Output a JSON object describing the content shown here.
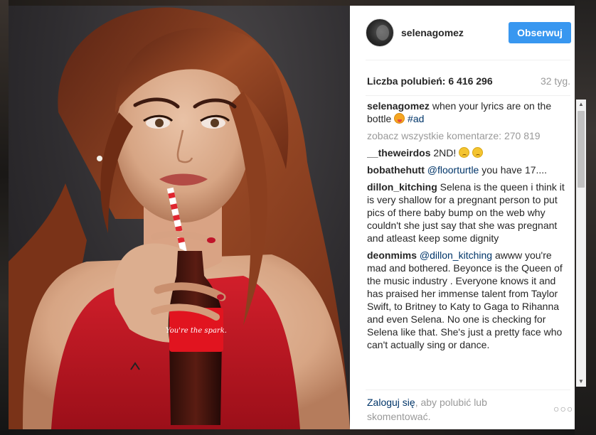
{
  "post": {
    "username": "selenagomez",
    "follow_label": "Obserwuj",
    "likes_text": "Liczba polubień: 6 416 296",
    "time_ago": "32 tyg.",
    "caption": {
      "author": "selenagomez",
      "text": " when your lyrics are on the bottle ",
      "emoji_icon": "face-with-tongue-icon",
      "hashtag": "#ad"
    },
    "view_all_comments": "zobacz wszystkie komentarze: 270 819"
  },
  "photo": {
    "bottle_label": "You're the spark."
  },
  "comments": [
    {
      "author": "__theweirdos",
      "mention": "",
      "text": " 2ND! ",
      "emoji_icon": "sad-face-icon"
    },
    {
      "author": "bobathehutt",
      "mention": "@floorturtle",
      "text": " you have 17....",
      "emoji_icon": ""
    },
    {
      "author": "dillon_kitching",
      "mention": "",
      "text": " Selena is the queen i think it is very shallow for a pregnant person to put pics of there baby bump on the web why couldn't she just say that she was pregnant and atleast keep some dignity",
      "emoji_icon": ""
    },
    {
      "author": "deonmims",
      "mention": "@dillon_kitching",
      "text": " awww you're mad and bothered. Beyonce is the Queen of the music industry . Everyone knows it and has praised her immense talent from Taylor Swift, to Britney to Katy to Gaga to Rihanna and even Selena. No one is checking for Selena like that. She's just a pretty face who can't actually sing or dance.",
      "emoji_icon": ""
    }
  ],
  "footer": {
    "login_link": "Zaloguj się",
    "login_rest": ", aby polubić lub skomentować.",
    "more_label": "○○○"
  },
  "scrollbar": {
    "up_arrow": "▲",
    "down_arrow": "▼"
  }
}
